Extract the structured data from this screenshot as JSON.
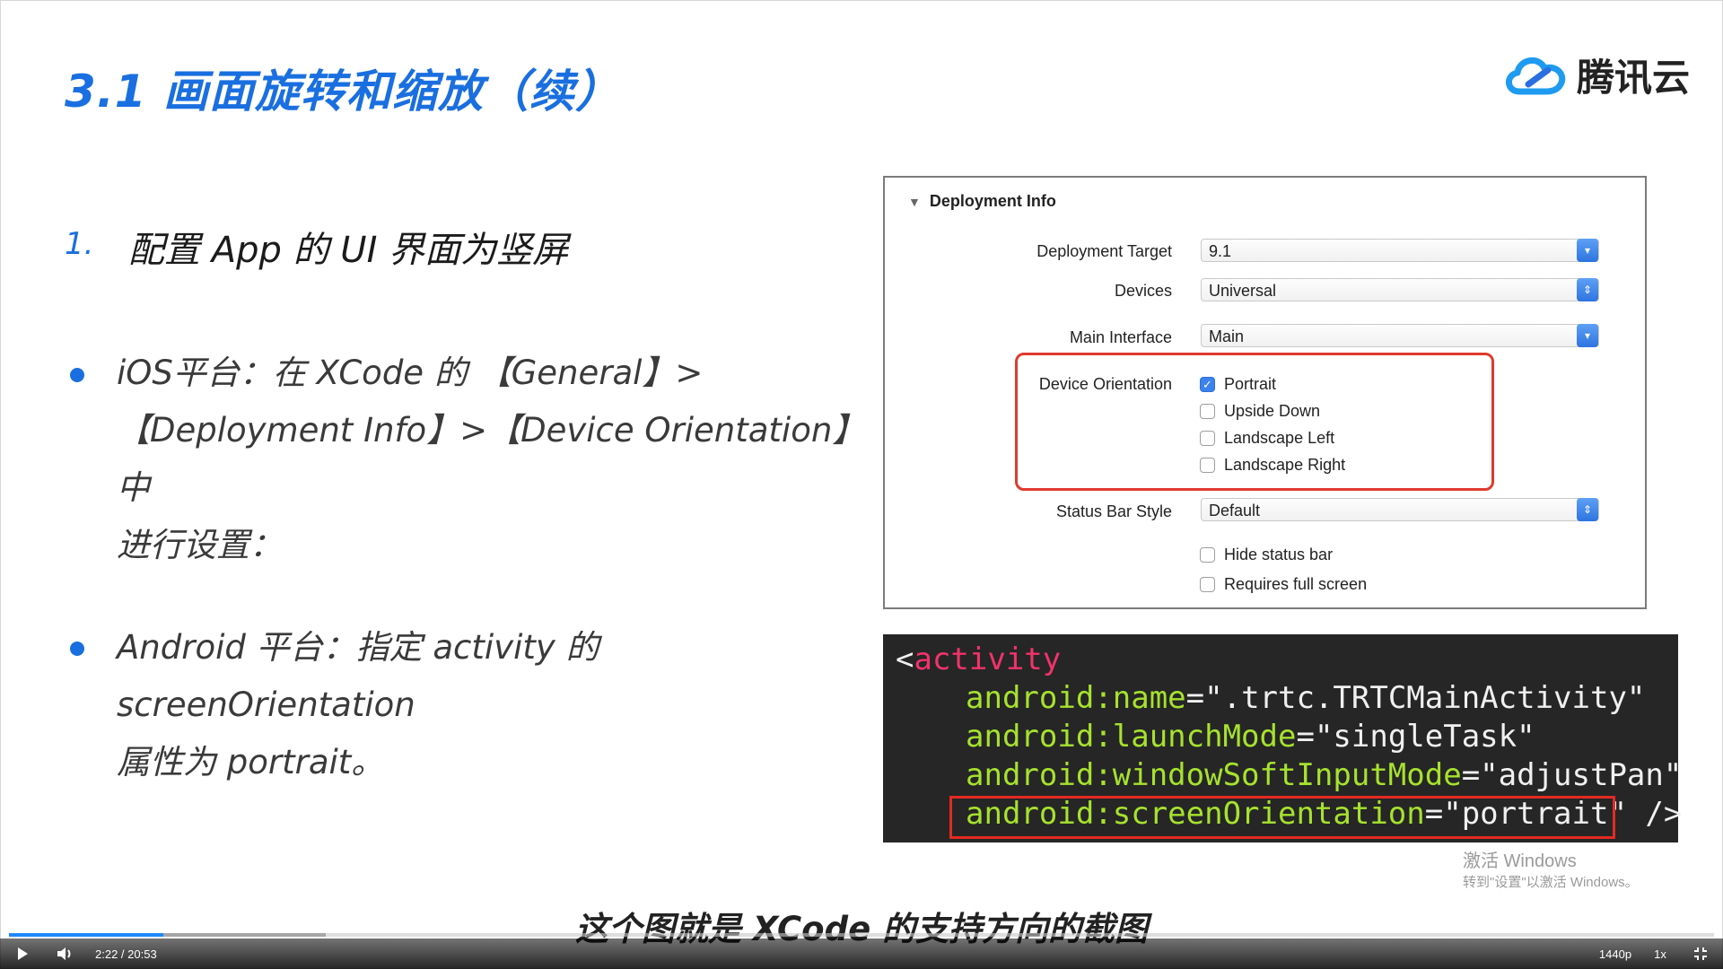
{
  "slide": {
    "title": "3.1 画面旋转和缩放（续）",
    "logo_text": "腾讯云"
  },
  "item1": {
    "number": "1.",
    "text": "配置 App 的 UI 界面为竖屏"
  },
  "bullets": [
    {
      "lines": [
        "iOS平台：在 XCode 的 【General】>",
        "【Deployment Info】>【Device Orientation】中",
        "进行设置："
      ]
    },
    {
      "lines": [
        "Android 平台：指定 activity 的 screenOrientation",
        "属性为 portrait。"
      ]
    }
  ],
  "xcode": {
    "section": "Deployment Info",
    "deployment_target_label": "Deployment Target",
    "deployment_target_value": "9.1",
    "devices_label": "Devices",
    "devices_value": "Universal",
    "main_interface_label": "Main Interface",
    "main_interface_value": "Main",
    "orientation_label": "Device Orientation",
    "orientations": [
      {
        "label": "Portrait",
        "checked": true
      },
      {
        "label": "Upside Down",
        "checked": false
      },
      {
        "label": "Landscape Left",
        "checked": false
      },
      {
        "label": "Landscape Right",
        "checked": false
      }
    ],
    "status_bar_label": "Status Bar Style",
    "status_bar_value": "Default",
    "hide_status_bar": {
      "label": "Hide status bar",
      "checked": false
    },
    "requires_full_screen": {
      "label": "Requires full screen",
      "checked": false
    }
  },
  "code": {
    "open": "<",
    "tag": "activity",
    "lines": [
      {
        "attr": "android:name",
        "eq": "=",
        "val": "\".trtc.TRTCMainActivity\""
      },
      {
        "attr": "android:launchMode",
        "eq": "=",
        "val": "\"singleTask\""
      },
      {
        "attr": "android:windowSoftInputMode",
        "eq": "=",
        "val": "\"adjustPan\""
      },
      {
        "attr": "android:screenOrientation",
        "eq": "=",
        "val": "\"portrait\"",
        "close": " />"
      }
    ]
  },
  "watermark": {
    "line1": "激活 Windows",
    "line2": "转到\"设置\"以激活 Windows。"
  },
  "subtitle": "这个图就是 XCode 的支持方向的截图",
  "player": {
    "time": "2:22 / 20:53",
    "played_fraction": 0.0906,
    "buffered_fraction": 0.186,
    "quality": "1440p",
    "speed": "1x",
    "icons": [
      "play-icon",
      "volume-icon",
      "exit-fullscreen-icon"
    ]
  }
}
